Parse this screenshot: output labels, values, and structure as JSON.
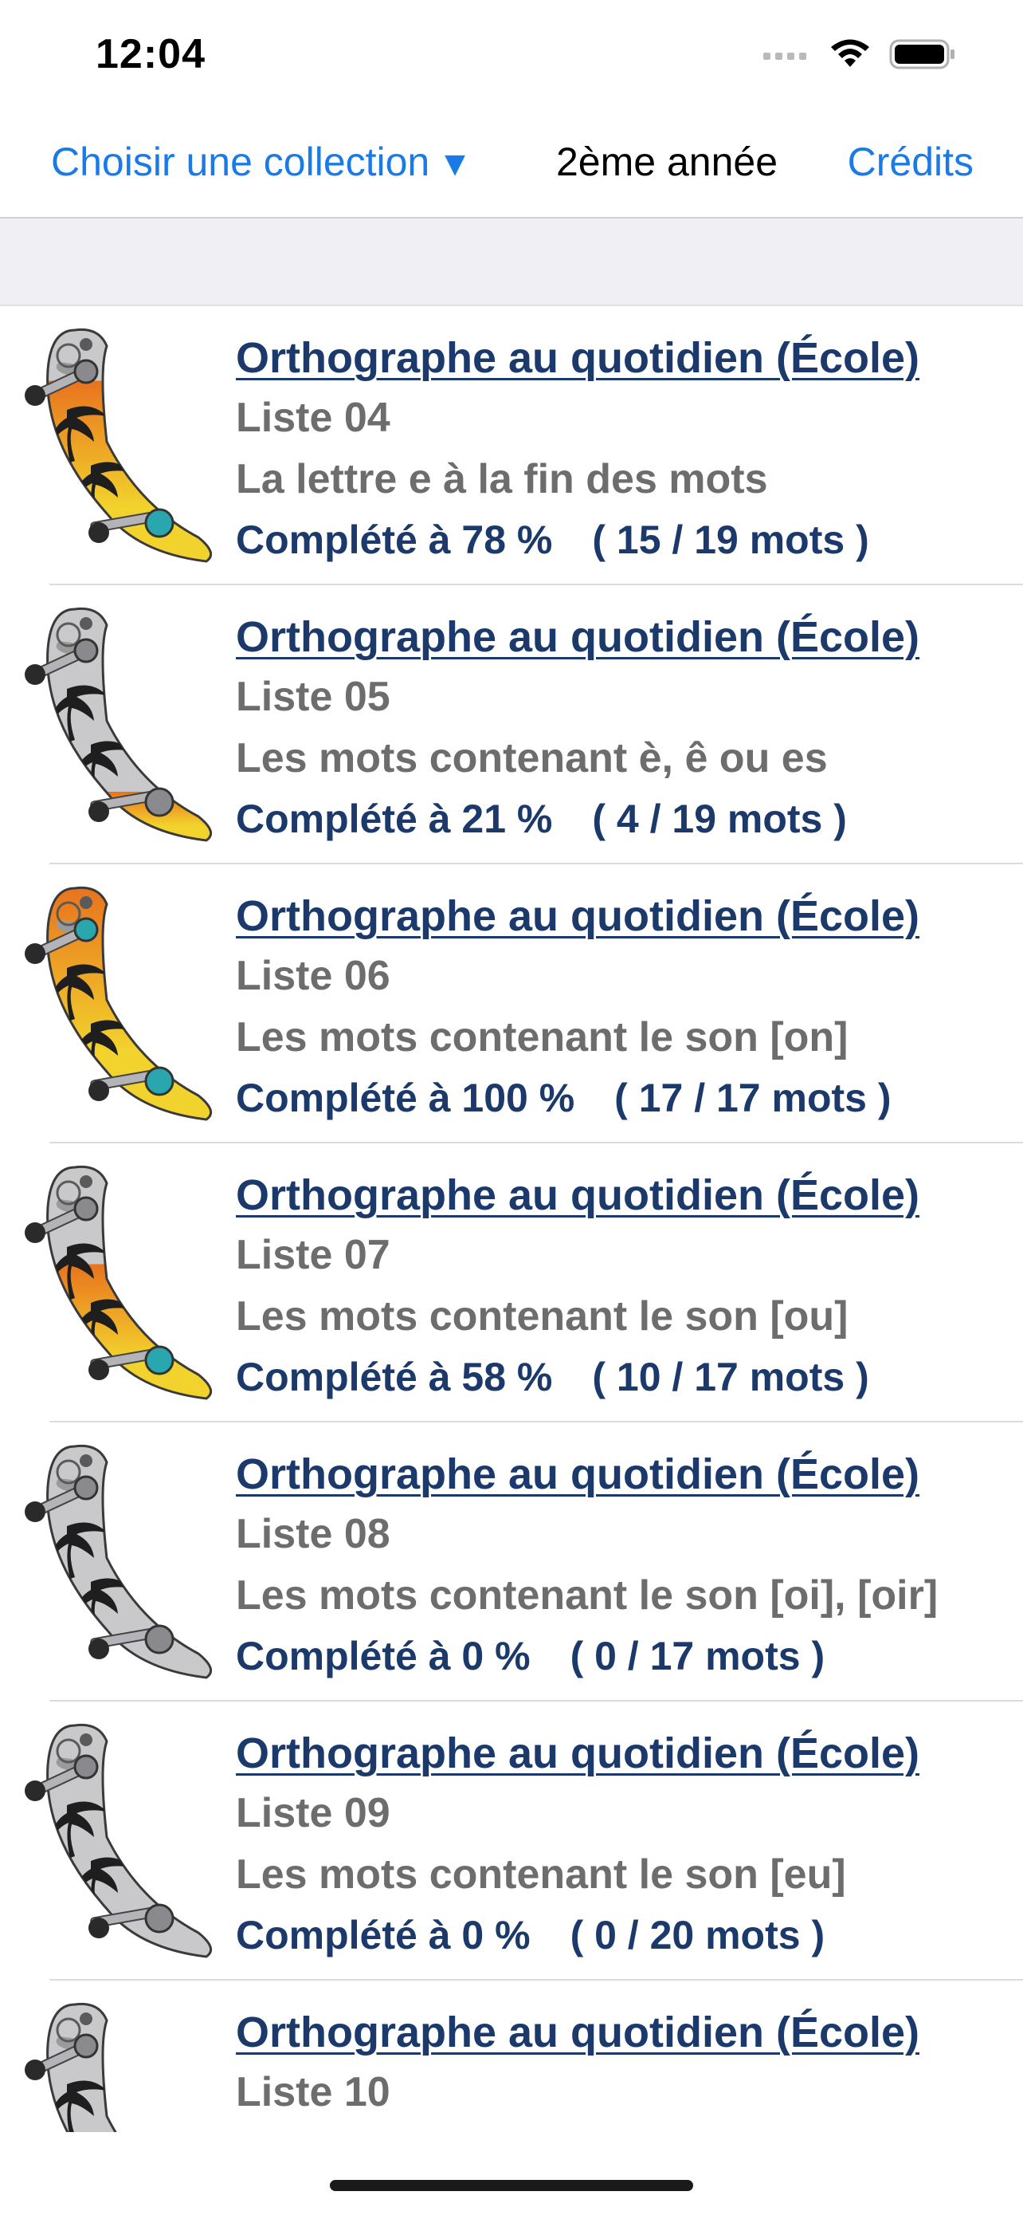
{
  "status": {
    "time": "12:04"
  },
  "nav": {
    "collection_label": "Choisir une collection",
    "collection_arrow": "▼",
    "title": "2ème année",
    "credits_label": "Crédits"
  },
  "items": [
    {
      "collection": "Orthographe au quotidien (École)",
      "list": "Liste 04",
      "description": "La lettre e à la fin des mots",
      "progress": "Complété à 78 %",
      "count": "( 15 / 19 mots )",
      "fill": 0.78
    },
    {
      "collection": "Orthographe au quotidien (École)",
      "list": "Liste 05",
      "description": "Les mots contenant è, ê ou es",
      "progress": "Complété à 21 %",
      "count": "( 4 / 19 mots )",
      "fill": 0.21
    },
    {
      "collection": "Orthographe au quotidien (École)",
      "list": "Liste 06",
      "description": "Les mots contenant le son [on]",
      "progress": "Complété à 100 %",
      "count": "( 17 / 17 mots )",
      "fill": 1.0
    },
    {
      "collection": "Orthographe au quotidien (École)",
      "list": "Liste 07",
      "description": "Les mots contenant le son [ou]",
      "progress": "Complété à 58 %",
      "count": "( 10 / 17 mots )",
      "fill": 0.58
    },
    {
      "collection": "Orthographe au quotidien (École)",
      "list": "Liste 08",
      "description": "Les mots contenant le son [oi], [oir]",
      "progress": "Complété à 0 %",
      "count": "( 0 / 17 mots )",
      "fill": 0.0
    },
    {
      "collection": "Orthographe au quotidien (École)",
      "list": "Liste 09",
      "description": "Les mots contenant le son [eu]",
      "progress": "Complété à 0 %",
      "count": "( 0 / 20 mots )",
      "fill": 0.0
    },
    {
      "collection": "Orthographe au quotidien (École)",
      "list": "Liste 10",
      "fill": 0.0
    }
  ],
  "colors": {
    "accent": "#1a7ae8",
    "title_text": "#1b3a6b",
    "secondary_text": "#6d6d6d",
    "board_gray": "#c9c9cb",
    "board_orange": "#e8731e",
    "board_yellow": "#f2d22c",
    "wheel_teal": "#2aa7ae"
  }
}
